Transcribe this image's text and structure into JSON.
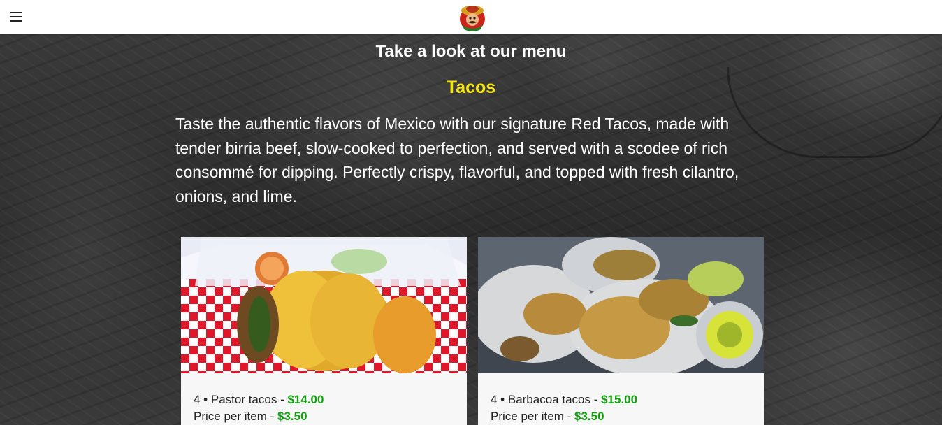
{
  "header": {
    "menu_icon": "hamburger-menu-icon",
    "logo_icon": "restaurant-mascot-logo"
  },
  "main": {
    "heading": "Take a look at our menu",
    "section_title": "Tacos",
    "section_description": "Taste the authentic flavors of Mexico with our signature Red Tacos, made with tender birria beef, slow-cooked to perfection, and served with a scodee of rich consommé for dipping. Perfectly crispy, flavorful, and topped with fresh cilantro, onions, and lime."
  },
  "cards": [
    {
      "name_prefix": "4 • Pastor tacos - ",
      "price": "$14.00",
      "per_item_label": "Price per item - ",
      "per_item_price": "$3.50"
    },
    {
      "name_prefix": "4 • Barbacoa tacos - ",
      "price": "$15.00",
      "per_item_label": "Price per item - ",
      "per_item_price": "$3.50"
    }
  ],
  "colors": {
    "accent_yellow": "#f5e614",
    "price_green": "#13a010",
    "header_bg": "#ffffff"
  }
}
